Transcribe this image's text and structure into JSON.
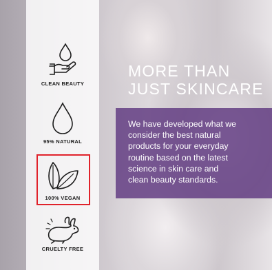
{
  "badges": [
    {
      "label": "CLEAN BEAUTY",
      "icon": "hand-drop-icon"
    },
    {
      "label": "95% NATURAL",
      "icon": "drop-icon"
    },
    {
      "label": "100% VEGAN",
      "icon": "leaves-icon"
    },
    {
      "label": "CRUELTY FREE",
      "icon": "rabbit-icon"
    }
  ],
  "headline": {
    "line1": "MORE THAN",
    "line2": "JUST SKINCARE"
  },
  "body": {
    "lines": [
      "We have developed what we",
      "consider the best natural",
      "products for your everyday",
      "routine based on the latest",
      "science in skin care and",
      "clean beauty standards."
    ]
  },
  "colors": {
    "purple": "#623c82",
    "highlight": "#e0222b",
    "icon": "#1c1c1c"
  }
}
